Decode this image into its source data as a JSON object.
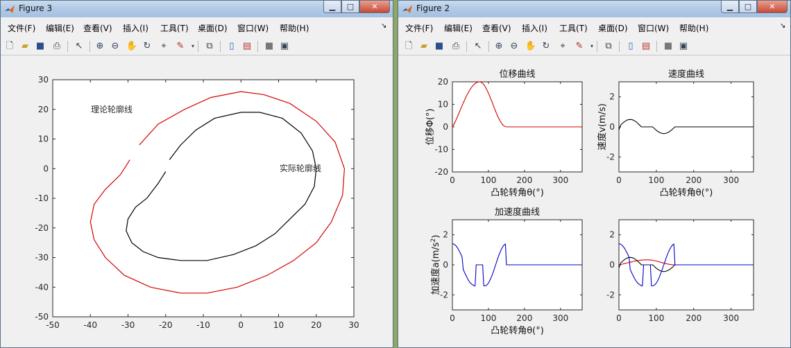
{
  "figure3": {
    "title": "Figure 3",
    "menu": [
      "文件(F)",
      "编辑(E)",
      "查看(V)",
      "插入(I)",
      "工具(T)",
      "桌面(D)",
      "窗口(W)",
      "帮助(H)"
    ],
    "chart_data": {
      "type": "line",
      "xlim": [
        -50,
        30
      ],
      "ylim": [
        -50,
        30
      ],
      "xticks": [
        "-50",
        "-40",
        "-30",
        "-20",
        "-10",
        "0",
        "10",
        "20",
        "30"
      ],
      "yticks": [
        "30",
        "20",
        "10",
        "0",
        "-10",
        "-20",
        "-30",
        "-40",
        "-50"
      ],
      "annotations": [
        "理论轮廓线",
        "实际轮廓线"
      ],
      "series_colors": [
        "#d40000",
        "#000000"
      ],
      "grid": false
    }
  },
  "figure2": {
    "title": "Figure 2",
    "menu": [
      "文件(F)",
      "编辑(E)",
      "查看(V)",
      "插入(I)",
      "工具(T)",
      "桌面(D)",
      "窗口(W)",
      "帮助(H)"
    ],
    "chart_data": [
      {
        "type": "line",
        "title": "位移曲线",
        "xlabel": "凸轮转角θ(°)",
        "ylabel": "位移Φ(°)",
        "xlim": [
          0,
          360
        ],
        "ylim": [
          -20,
          20
        ],
        "xticks": [
          "0",
          "100",
          "200",
          "300"
        ],
        "yticks": [
          "20",
          "10",
          "0",
          "-10",
          "-20"
        ],
        "series_colors": [
          "#d40000"
        ]
      },
      {
        "type": "line",
        "title": "速度曲线",
        "xlabel": "凸轮转角θ(°)",
        "ylabel": "速度v(m/s)",
        "xlim": [
          0,
          360
        ],
        "ylim": [
          -3,
          3
        ],
        "xticks": [
          "0",
          "100",
          "200",
          "300"
        ],
        "yticks": [
          "2",
          "0",
          "-2"
        ],
        "series_colors": [
          "#000000"
        ]
      },
      {
        "type": "line",
        "title": "加速度曲线",
        "xlabel": "凸轮转角θ(°)",
        "ylabel": "加速度a(m/s",
        "ylabel_sup": "2",
        "ylabel_end": ")",
        "xlim": [
          0,
          360
        ],
        "ylim": [
          -3,
          3
        ],
        "xticks": [
          "0",
          "100",
          "200",
          "300"
        ],
        "yticks": [
          "2",
          "0",
          "-2"
        ],
        "series_colors": [
          "#0000c8"
        ]
      },
      {
        "type": "line",
        "title": "",
        "xlabel": "",
        "ylabel": "",
        "xlim": [
          0,
          360
        ],
        "ylim": [
          -3,
          3
        ],
        "xticks": [
          "0",
          "100",
          "200",
          "300"
        ],
        "yticks": [
          "2",
          "0",
          "-2"
        ],
        "series_colors": [
          "#d40000",
          "#000000",
          "#0000c8"
        ]
      }
    ]
  }
}
